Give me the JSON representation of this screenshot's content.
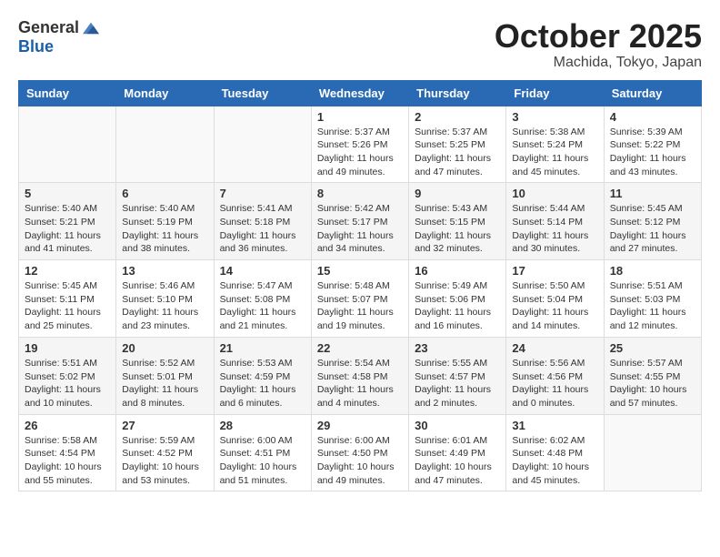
{
  "header": {
    "logo_general": "General",
    "logo_blue": "Blue",
    "month_title": "October 2025",
    "location": "Machida, Tokyo, Japan"
  },
  "weekdays": [
    "Sunday",
    "Monday",
    "Tuesday",
    "Wednesday",
    "Thursday",
    "Friday",
    "Saturday"
  ],
  "weeks": [
    [
      {
        "day": "",
        "info": ""
      },
      {
        "day": "",
        "info": ""
      },
      {
        "day": "",
        "info": ""
      },
      {
        "day": "1",
        "info": "Sunrise: 5:37 AM\nSunset: 5:26 PM\nDaylight: 11 hours\nand 49 minutes."
      },
      {
        "day": "2",
        "info": "Sunrise: 5:37 AM\nSunset: 5:25 PM\nDaylight: 11 hours\nand 47 minutes."
      },
      {
        "day": "3",
        "info": "Sunrise: 5:38 AM\nSunset: 5:24 PM\nDaylight: 11 hours\nand 45 minutes."
      },
      {
        "day": "4",
        "info": "Sunrise: 5:39 AM\nSunset: 5:22 PM\nDaylight: 11 hours\nand 43 minutes."
      }
    ],
    [
      {
        "day": "5",
        "info": "Sunrise: 5:40 AM\nSunset: 5:21 PM\nDaylight: 11 hours\nand 41 minutes."
      },
      {
        "day": "6",
        "info": "Sunrise: 5:40 AM\nSunset: 5:19 PM\nDaylight: 11 hours\nand 38 minutes."
      },
      {
        "day": "7",
        "info": "Sunrise: 5:41 AM\nSunset: 5:18 PM\nDaylight: 11 hours\nand 36 minutes."
      },
      {
        "day": "8",
        "info": "Sunrise: 5:42 AM\nSunset: 5:17 PM\nDaylight: 11 hours\nand 34 minutes."
      },
      {
        "day": "9",
        "info": "Sunrise: 5:43 AM\nSunset: 5:15 PM\nDaylight: 11 hours\nand 32 minutes."
      },
      {
        "day": "10",
        "info": "Sunrise: 5:44 AM\nSunset: 5:14 PM\nDaylight: 11 hours\nand 30 minutes."
      },
      {
        "day": "11",
        "info": "Sunrise: 5:45 AM\nSunset: 5:12 PM\nDaylight: 11 hours\nand 27 minutes."
      }
    ],
    [
      {
        "day": "12",
        "info": "Sunrise: 5:45 AM\nSunset: 5:11 PM\nDaylight: 11 hours\nand 25 minutes."
      },
      {
        "day": "13",
        "info": "Sunrise: 5:46 AM\nSunset: 5:10 PM\nDaylight: 11 hours\nand 23 minutes."
      },
      {
        "day": "14",
        "info": "Sunrise: 5:47 AM\nSunset: 5:08 PM\nDaylight: 11 hours\nand 21 minutes."
      },
      {
        "day": "15",
        "info": "Sunrise: 5:48 AM\nSunset: 5:07 PM\nDaylight: 11 hours\nand 19 minutes."
      },
      {
        "day": "16",
        "info": "Sunrise: 5:49 AM\nSunset: 5:06 PM\nDaylight: 11 hours\nand 16 minutes."
      },
      {
        "day": "17",
        "info": "Sunrise: 5:50 AM\nSunset: 5:04 PM\nDaylight: 11 hours\nand 14 minutes."
      },
      {
        "day": "18",
        "info": "Sunrise: 5:51 AM\nSunset: 5:03 PM\nDaylight: 11 hours\nand 12 minutes."
      }
    ],
    [
      {
        "day": "19",
        "info": "Sunrise: 5:51 AM\nSunset: 5:02 PM\nDaylight: 11 hours\nand 10 minutes."
      },
      {
        "day": "20",
        "info": "Sunrise: 5:52 AM\nSunset: 5:01 PM\nDaylight: 11 hours\nand 8 minutes."
      },
      {
        "day": "21",
        "info": "Sunrise: 5:53 AM\nSunset: 4:59 PM\nDaylight: 11 hours\nand 6 minutes."
      },
      {
        "day": "22",
        "info": "Sunrise: 5:54 AM\nSunset: 4:58 PM\nDaylight: 11 hours\nand 4 minutes."
      },
      {
        "day": "23",
        "info": "Sunrise: 5:55 AM\nSunset: 4:57 PM\nDaylight: 11 hours\nand 2 minutes."
      },
      {
        "day": "24",
        "info": "Sunrise: 5:56 AM\nSunset: 4:56 PM\nDaylight: 11 hours\nand 0 minutes."
      },
      {
        "day": "25",
        "info": "Sunrise: 5:57 AM\nSunset: 4:55 PM\nDaylight: 10 hours\nand 57 minutes."
      }
    ],
    [
      {
        "day": "26",
        "info": "Sunrise: 5:58 AM\nSunset: 4:54 PM\nDaylight: 10 hours\nand 55 minutes."
      },
      {
        "day": "27",
        "info": "Sunrise: 5:59 AM\nSunset: 4:52 PM\nDaylight: 10 hours\nand 53 minutes."
      },
      {
        "day": "28",
        "info": "Sunrise: 6:00 AM\nSunset: 4:51 PM\nDaylight: 10 hours\nand 51 minutes."
      },
      {
        "day": "29",
        "info": "Sunrise: 6:00 AM\nSunset: 4:50 PM\nDaylight: 10 hours\nand 49 minutes."
      },
      {
        "day": "30",
        "info": "Sunrise: 6:01 AM\nSunset: 4:49 PM\nDaylight: 10 hours\nand 47 minutes."
      },
      {
        "day": "31",
        "info": "Sunrise: 6:02 AM\nSunset: 4:48 PM\nDaylight: 10 hours\nand 45 minutes."
      },
      {
        "day": "",
        "info": ""
      }
    ]
  ]
}
